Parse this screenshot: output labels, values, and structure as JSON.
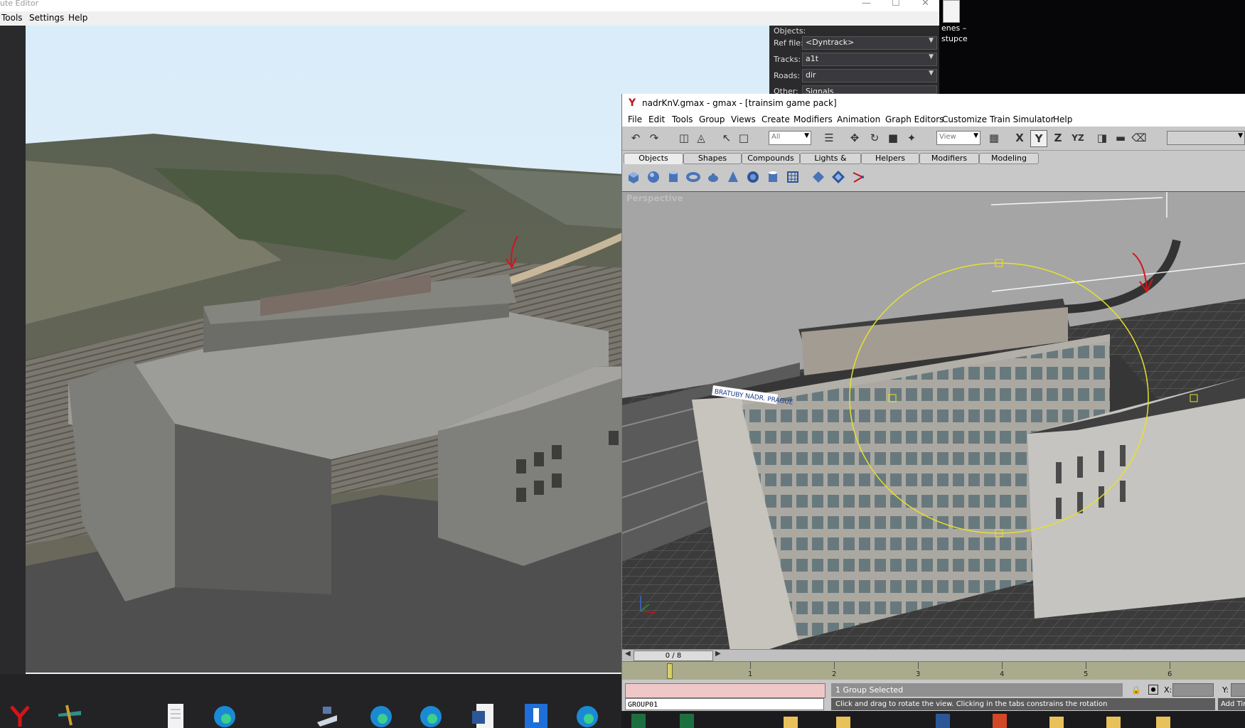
{
  "route_editor": {
    "title": "ute Editor",
    "menu": [
      "Tools",
      "Settings",
      "Help"
    ],
    "panel": {
      "section_title": "Objects:",
      "fields": [
        {
          "label": "Ref file:",
          "value": "<Dyntrack>"
        },
        {
          "label": "Tracks:",
          "value": "a1t"
        },
        {
          "label": "Roads:",
          "value": "dir"
        },
        {
          "label": "Other:",
          "value": "Signals"
        }
      ]
    }
  },
  "desktop": {
    "text_line1": "enes –",
    "text_line2": "stupce"
  },
  "gmax": {
    "title": "nadrKnV.gmax - gmax - [trainsim game pack]",
    "menu": [
      "File",
      "Edit",
      "Tools",
      "Group",
      "Views",
      "Create",
      "Modifiers",
      "Animation",
      "Graph Editors",
      "Customize",
      "Train Simulator",
      "Help"
    ],
    "toolbar": {
      "filter_value": "All",
      "coord_value": "View",
      "axis_labels": [
        "X",
        "Y",
        "Z",
        "YZ"
      ]
    },
    "tabs": [
      "Objects",
      "Shapes",
      "Compounds",
      "Lights & Cameras",
      "Helpers",
      "Modifiers",
      "Modeling"
    ],
    "active_tab": "Objects",
    "viewport_label": "Perspective",
    "building_sign": "BRATUBY NÁDR. PRAGUE",
    "time_slider": "0 / 8",
    "track_numbers": [
      "1",
      "2",
      "3",
      "4",
      "5",
      "6"
    ],
    "status": {
      "selection": "1 Group Selected",
      "object_name": "GROUP01",
      "prompt": "Click and drag to rotate the view.  Clicking in the tabs constrains the rotation",
      "x_label": "X:",
      "y_label": "Y:",
      "add_time_tag": "Add Time Tag"
    }
  },
  "colors": {
    "gmax_bg": "#c8c8c8",
    "gizmo": "#e6e22a",
    "annotation_arrow": "#d4141a",
    "status_pink": "#efc7c7"
  }
}
